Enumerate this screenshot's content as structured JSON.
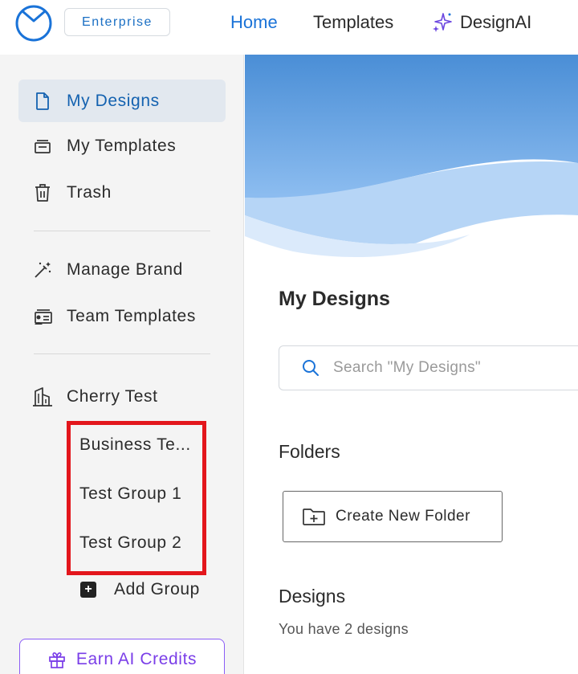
{
  "topbar": {
    "plan_badge": "Enterprise",
    "nav": [
      {
        "label": "Home",
        "active": true
      },
      {
        "label": "Templates"
      },
      {
        "label": "DesignAI"
      }
    ]
  },
  "sidebar": {
    "items": [
      {
        "label": "My Designs",
        "icon": "document-icon",
        "active": true
      },
      {
        "label": "My Templates",
        "icon": "templates-icon"
      },
      {
        "label": "Trash",
        "icon": "trash-icon"
      },
      {
        "label": "Manage Brand",
        "icon": "magic-wand-icon"
      },
      {
        "label": "Team Templates",
        "icon": "team-templates-icon"
      }
    ],
    "team": {
      "label": "Cherry Test",
      "icon": "building-icon"
    },
    "groups": [
      "Business Te...",
      "Test Group 1",
      "Test Group 2"
    ],
    "add_group_label": "Add Group",
    "earn_label": "Earn AI Credits"
  },
  "main": {
    "title": "My Designs",
    "search_placeholder": "Search \"My Designs\"",
    "folders_heading": "Folders",
    "create_folder_label": "Create New Folder",
    "designs_heading": "Designs",
    "designs_count_text": "You have 2 designs"
  },
  "colors": {
    "accent": "#1a73d8",
    "active_bg": "#e2e8ef",
    "highlight_box": "#e3161c",
    "ai_purple": "#7a3ee8"
  }
}
